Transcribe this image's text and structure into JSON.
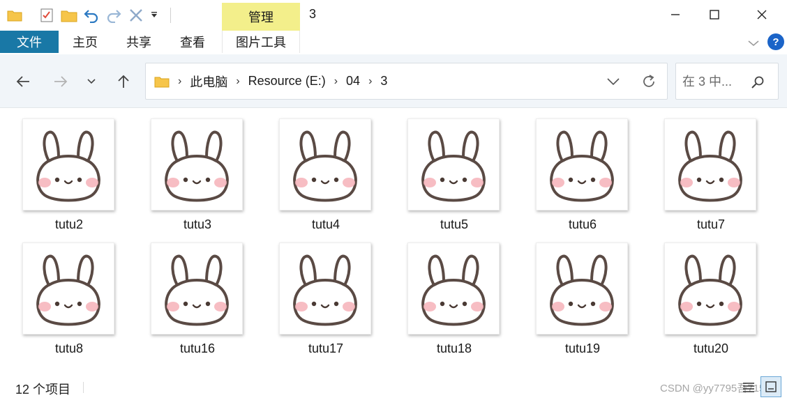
{
  "window": {
    "title": "3",
    "manage_tab": "管理"
  },
  "ribbon": {
    "tabs": [
      {
        "label": "文件"
      },
      {
        "label": "主页"
      },
      {
        "label": "共享"
      },
      {
        "label": "查看"
      },
      {
        "label": "图片工具"
      }
    ],
    "help_label": "?"
  },
  "navigation": {
    "breadcrumbs": [
      "此电脑",
      "Resource (E:)",
      "04",
      "3"
    ]
  },
  "search": {
    "placeholder": "在 3 中..."
  },
  "files": [
    {
      "name": "tutu2"
    },
    {
      "name": "tutu3"
    },
    {
      "name": "tutu4"
    },
    {
      "name": "tutu5"
    },
    {
      "name": "tutu6"
    },
    {
      "name": "tutu7"
    },
    {
      "name": "tutu8"
    },
    {
      "name": "tutu16"
    },
    {
      "name": "tutu17"
    },
    {
      "name": "tutu18"
    },
    {
      "name": "tutu19"
    },
    {
      "name": "tutu20"
    }
  ],
  "status": {
    "item_count": "12 个项目",
    "watermark": "CSDN @yy7795吾715"
  },
  "colors": {
    "file_tab": "#1978a6",
    "manage_tab": "#f3ef8b",
    "nav_background": "#f1f5f9",
    "folder": "#f6c54a",
    "rabbit_outline": "#5a4a44",
    "blush": "#f6b6bd"
  },
  "icons": {
    "folder": "folder-icon",
    "properties": "properties-icon",
    "new_folder": "new-folder-icon",
    "undo": "undo-icon",
    "redo": "redo-icon",
    "delete": "delete-icon",
    "customize": "chevron-down-icon",
    "back": "back-arrow-icon",
    "forward": "forward-arrow-icon",
    "up": "up-arrow-icon",
    "refresh": "refresh-icon",
    "search": "search-icon"
  }
}
